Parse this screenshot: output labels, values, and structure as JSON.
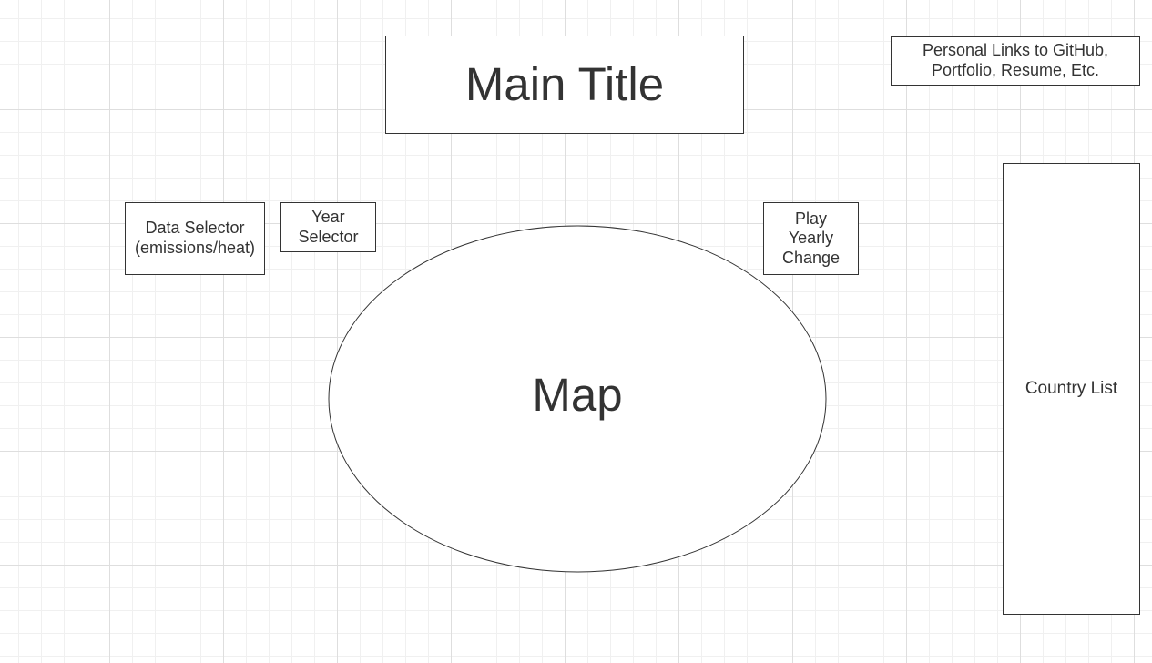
{
  "title": "Main Title",
  "personal_links": "Personal Links to GitHub,\nPortfolio, Resume, Etc.",
  "data_selector": "Data Selector\n(emissions/heat)",
  "year_selector": "Year\nSelector",
  "play_button": "Play\nYearly\nChange",
  "map": "Map",
  "country_list": "Country List",
  "colors": {
    "stroke": "#333333",
    "fill": "#ffffff",
    "grid_major": "#dedede",
    "grid_minor": "#f0f0f0"
  }
}
